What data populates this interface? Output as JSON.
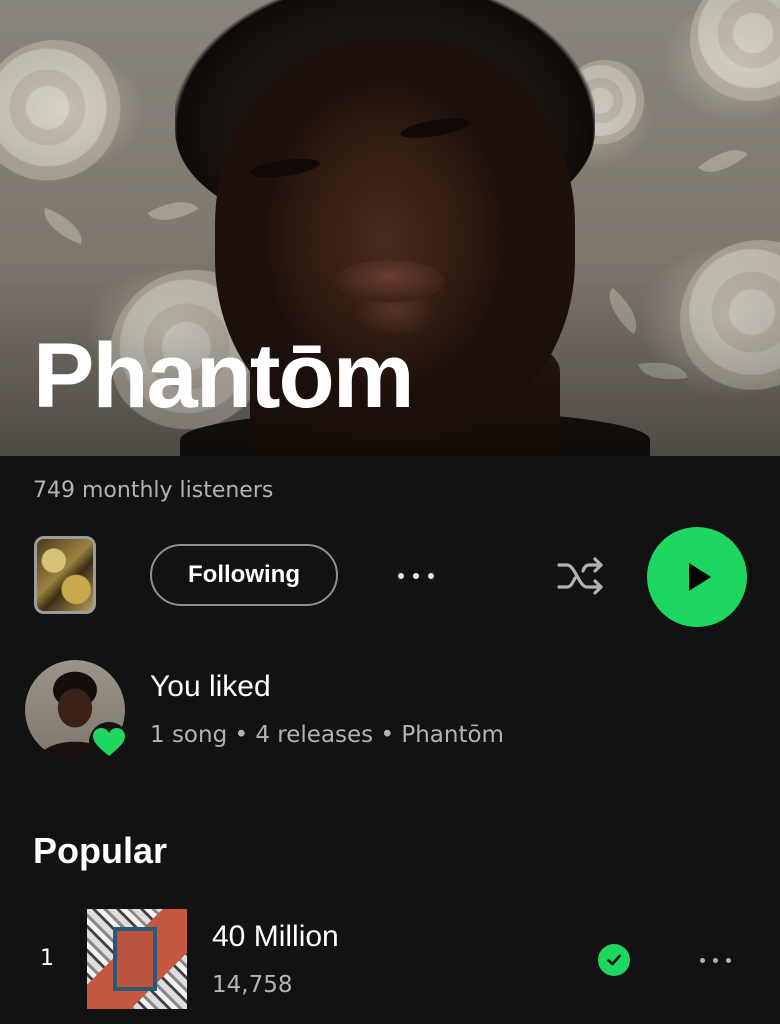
{
  "artist": {
    "name": "Phantōm",
    "monthly_listeners": "749 monthly listeners"
  },
  "actions": {
    "follow_label": "Following",
    "more_icon": "more-horizontal-icon",
    "shuffle_icon": "shuffle-icon",
    "play_icon": "play-icon",
    "accent_color": "#1ed760"
  },
  "liked": {
    "title": "You liked",
    "subtitle": "1 song • 4 releases • Phantōm",
    "badge_icon": "heart-icon"
  },
  "popular": {
    "heading": "Popular",
    "tracks": [
      {
        "number": "1",
        "title": "40 Million",
        "plays": "14,758",
        "added": true
      }
    ]
  },
  "colors": {
    "background": "#121212",
    "text_primary": "#ffffff",
    "text_secondary": "#b3b3b3",
    "accent": "#1ed760"
  }
}
